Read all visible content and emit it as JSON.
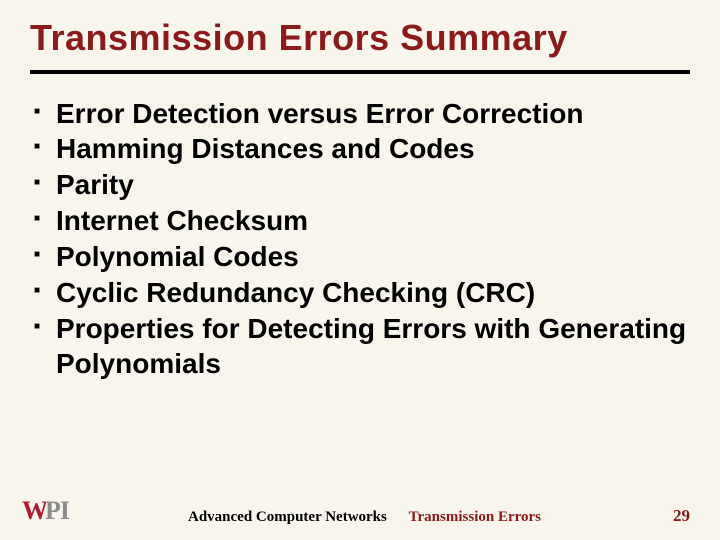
{
  "title": "Transmission Errors Summary",
  "bullets": [
    "Error Detection versus Error Correction",
    "Hamming Distances and Codes",
    "Parity",
    "Internet Checksum",
    "Polynomial Codes",
    "Cyclic Redundancy Checking (CRC)",
    "Properties for Detecting Errors with Generating Polynomials"
  ],
  "footer": {
    "logo": {
      "w": "W",
      "pi": "PI"
    },
    "course": "Advanced Computer Networks",
    "section": "Transmission Errors",
    "page": "29"
  }
}
